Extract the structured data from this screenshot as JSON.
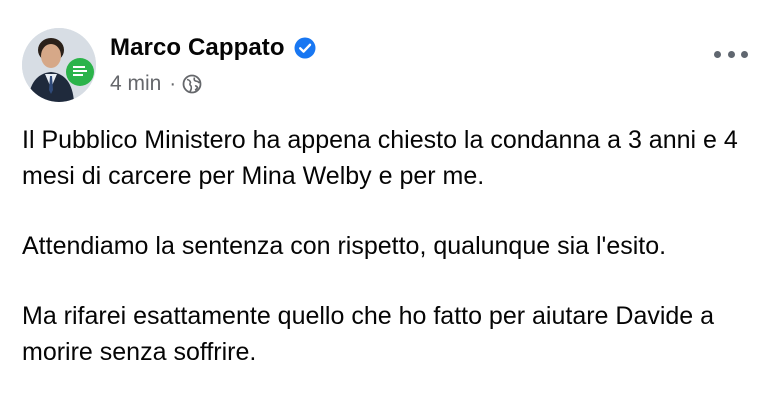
{
  "post": {
    "author": "Marco Cappato",
    "verified": true,
    "timestamp": "4 min",
    "separator": "·",
    "audience_icon": "globe-icon",
    "more_icon": "more-options-icon",
    "paragraphs": [
      "Il Pubblico Ministero ha appena chiesto la condanna a 3 anni e 4 mesi di carcere per Mina Welby e per me.",
      "Attendiamo la sentenza con rispetto, qualunque sia l'esito.",
      "Ma rifarei esattamente quello che ho fatto per aiutare Davide a morire senza soffrire."
    ]
  },
  "colors": {
    "verified_blue": "#1877f2",
    "secondary_text": "#65676b",
    "primary_text": "#050505",
    "badge_green": "#2bb34a"
  }
}
